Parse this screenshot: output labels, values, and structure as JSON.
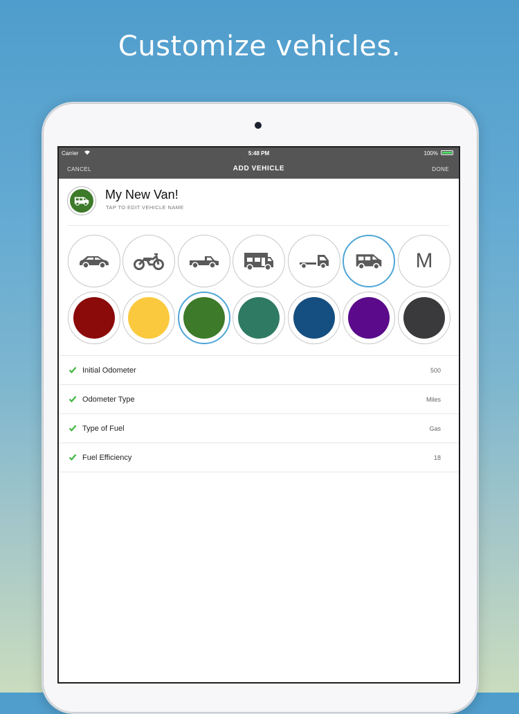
{
  "headline": "Customize vehicles.",
  "status_bar": {
    "carrier": "Carrier",
    "time": "5:48 PM",
    "battery": "100%"
  },
  "nav": {
    "cancel_label": "CANCEL",
    "title": "ADD VEHICLE",
    "done_label": "DONE"
  },
  "vehicle": {
    "name": "My New Van!",
    "hint": "TAP TO EDIT VEHICLE NAME",
    "avatar_icon": "van-icon",
    "avatar_color": "#3d7a2a"
  },
  "vehicle_types": [
    {
      "icon": "car-icon",
      "selected": false
    },
    {
      "icon": "motorcycle-icon",
      "selected": false
    },
    {
      "icon": "pickup-truck-icon",
      "selected": false
    },
    {
      "icon": "rv-icon",
      "selected": false
    },
    {
      "icon": "semi-truck-icon",
      "selected": false
    },
    {
      "icon": "van-icon",
      "selected": true
    },
    {
      "icon": "letter-m-icon",
      "label": "M",
      "selected": false
    }
  ],
  "colors": [
    {
      "hex": "#8b0a0a",
      "selected": false
    },
    {
      "hex": "#fbc93d",
      "selected": false
    },
    {
      "hex": "#3d7a2a",
      "selected": true
    },
    {
      "hex": "#2f7a63",
      "selected": false
    },
    {
      "hex": "#154e80",
      "selected": false
    },
    {
      "hex": "#5a0a8a",
      "selected": false
    },
    {
      "hex": "#3a3a3c",
      "selected": false
    }
  ],
  "settings": [
    {
      "label": "Initial Odometer",
      "value": "500"
    },
    {
      "label": "Odometer Type",
      "value": "Miles"
    },
    {
      "label": "Type of Fuel",
      "value": "Gas"
    },
    {
      "label": "Fuel Efficiency",
      "value": "18"
    }
  ],
  "accent_color": "#4ea6d6",
  "check_color": "#3fb53f"
}
